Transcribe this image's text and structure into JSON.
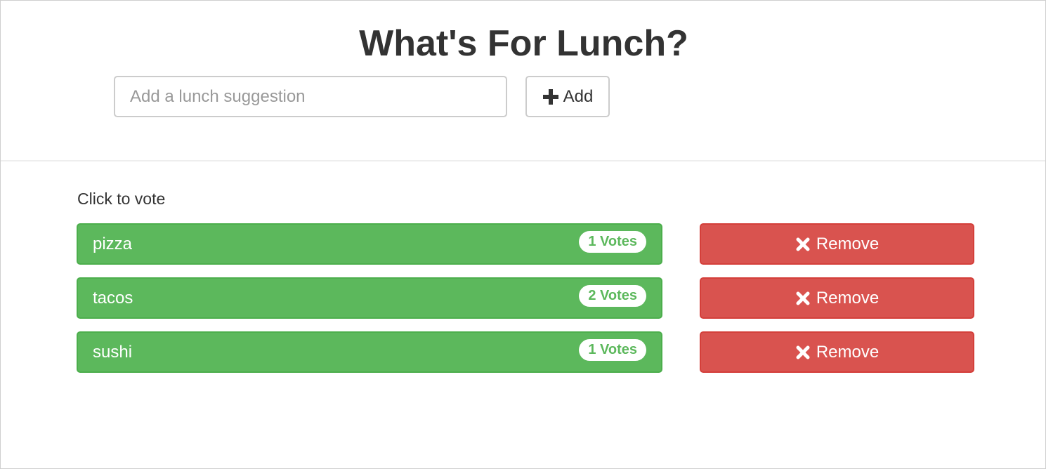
{
  "header": {
    "title": "What's For Lunch?"
  },
  "suggestion": {
    "placeholder": "Add a lunch suggestion",
    "value": "",
    "add_label": "Add",
    "add_icon": "plus-icon"
  },
  "list": {
    "hint": "Click to vote",
    "remove_label": "Remove",
    "remove_icon": "x-icon",
    "items": [
      {
        "name": "pizza",
        "votes": "1 Votes"
      },
      {
        "name": "tacos",
        "votes": "2 Votes"
      },
      {
        "name": "sushi",
        "votes": "1 Votes"
      }
    ]
  },
  "colors": {
    "vote_button": "#5cb85c",
    "remove_button": "#d9534f"
  }
}
